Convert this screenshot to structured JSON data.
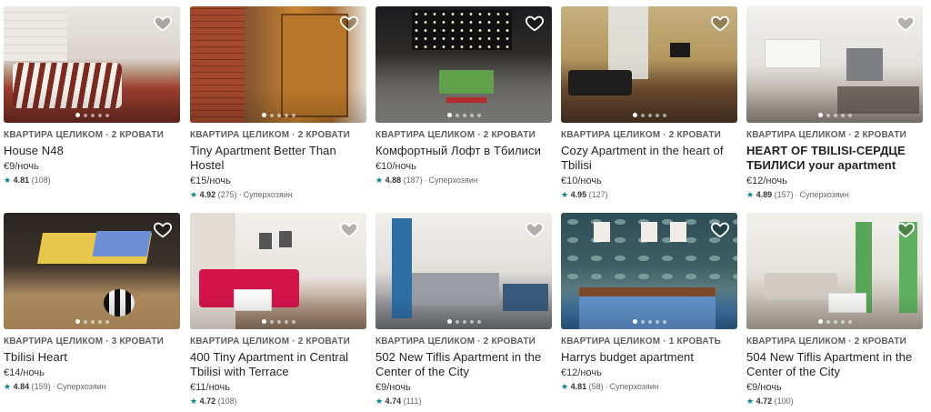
{
  "listings": [
    {
      "kind": "КВАРТИРА ЦЕЛИКОМ · 2 КРОВАТИ",
      "title": "House N48",
      "price": "€9/ночь",
      "rating": "4.81",
      "reviews": "(108)",
      "badge": ""
    },
    {
      "kind": "КВАРТИРА ЦЕЛИКОМ · 2 КРОВАТИ",
      "title": "Tiny Apartment Better Than Hostel",
      "price": "€15/ночь",
      "rating": "4.92",
      "reviews": "(275)",
      "badge": "Суперхозяин"
    },
    {
      "kind": "КВАРТИРА ЦЕЛИКОМ · 2 КРОВАТИ",
      "title": "Комфортный Лофт в Тбилиси",
      "price": "€10/ночь",
      "rating": "4.88",
      "reviews": "(187)",
      "badge": "Суперхозяин"
    },
    {
      "kind": "КВАРТИРА ЦЕЛИКОМ · 2 КРОВАТИ",
      "title": "Cozy Apartment in the heart of Tbilisi",
      "price": "€10/ночь",
      "rating": "4.95",
      "reviews": "(127)",
      "badge": ""
    },
    {
      "kind": "КВАРТИРА ЦЕЛИКОМ · 2 КРОВАТИ",
      "title": "HEART OF TBILISI-СЕРДЦЕ ТБИЛИСИ your apartment",
      "price": "€12/ночь",
      "rating": "4.89",
      "reviews": "(157)",
      "badge": "Суперхозяин"
    },
    {
      "kind": "КВАРТИРА ЦЕЛИКОМ · 3 КРОВАТИ",
      "title": "Tbilisi Heart",
      "price": "€14/ночь",
      "rating": "4.84",
      "reviews": "(159)",
      "badge": "Суперхозяин"
    },
    {
      "kind": "КВАРТИРА ЦЕЛИКОМ · 2 КРОВАТИ",
      "title": "400 Tiny Apartment in Central Tbilisi with Terrace",
      "price": "€11/ночь",
      "rating": "4.72",
      "reviews": "(108)",
      "badge": ""
    },
    {
      "kind": "КВАРТИРА ЦЕЛИКОМ · 2 КРОВАТИ",
      "title": "502 New Tiflis Apartment in the Center of the City",
      "price": "€9/ночь",
      "rating": "4.74",
      "reviews": "(111)",
      "badge": ""
    },
    {
      "kind": "КВАРТИРА ЦЕЛИКОМ · 1 КРОВАТЬ",
      "title": "Harrys budget apartment",
      "price": "€12/ночь",
      "rating": "4.81",
      "reviews": "(58)",
      "badge": "Суперхозяин"
    },
    {
      "kind": "КВАРТИРА ЦЕЛИКОМ · 2 КРОВАТИ",
      "title": "504 New Tiflis Apartment in the Center of the City",
      "price": "€9/ночь",
      "rating": "4.72",
      "reviews": "(100)",
      "badge": ""
    }
  ],
  "icons": {
    "favorite": "heart-outline-icon",
    "rating": "star-icon"
  },
  "colors": {
    "star": "#00838a",
    "kind_text": "#5c5c5c"
  }
}
